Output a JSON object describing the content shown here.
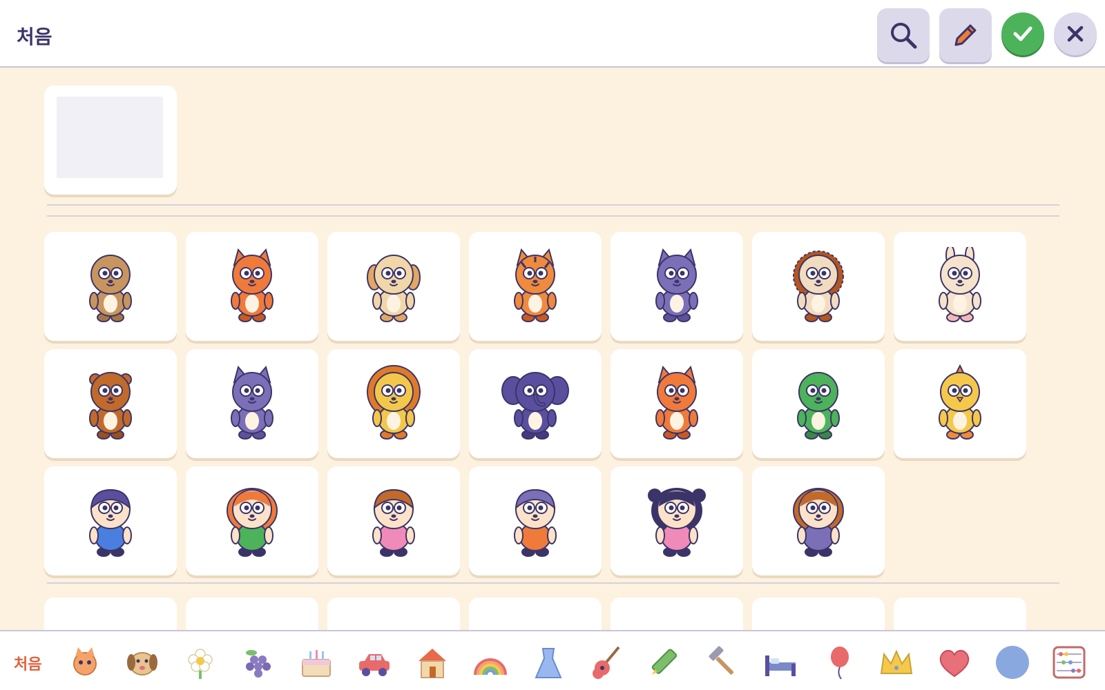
{
  "header": {
    "title": "처음",
    "buttons": {
      "search": "search-icon",
      "edit": "pencil-icon",
      "confirm": "check-icon",
      "close": "close-icon"
    }
  },
  "colors": {
    "accent_green": "#4cb35a",
    "title_text": "#3b3468",
    "background": "#fdf1e0",
    "first_label": "#e0603a"
  },
  "characters": [
    [
      "bear",
      "fox",
      "dog",
      "tiger",
      "cat",
      "hedgehog",
      "rabbit"
    ],
    [
      "brown-bear",
      "wolf",
      "lion",
      "elephant",
      "red-fox",
      "frog",
      "chick"
    ],
    [
      "boy-blue",
      "girl-green",
      "girl-pink",
      "kid-orange",
      "girl-pigtails",
      "girl-purple"
    ]
  ],
  "bottom_nav": {
    "first_label": "처음",
    "categories": [
      "fox-icon",
      "dog-icon",
      "flower-icon",
      "grapes-icon",
      "cake-icon",
      "car-icon",
      "house-icon",
      "rainbow-icon",
      "dress-icon",
      "guitar-icon",
      "crayon-icon",
      "hammer-icon",
      "bed-icon",
      "balloon-icon",
      "crown-icon",
      "heart-icon",
      "circle-icon",
      "abacus-icon"
    ]
  }
}
